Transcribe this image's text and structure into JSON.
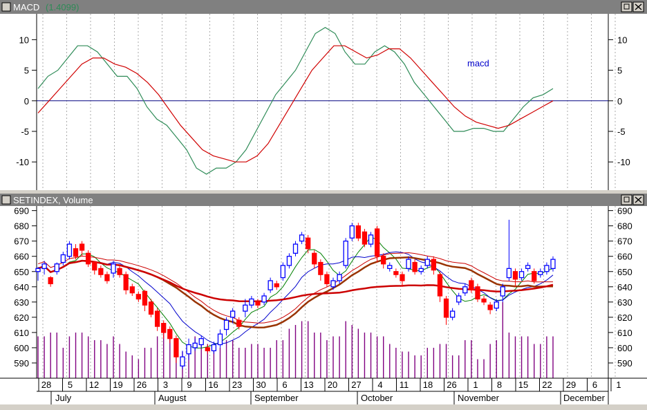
{
  "macd_pane": {
    "title": "MACD",
    "title_value": "(1.4099)",
    "annotation": "macd",
    "y_ticks": [
      10,
      5,
      0,
      -5,
      -10
    ],
    "ylim": [
      -14.5,
      14
    ]
  },
  "price_pane": {
    "title": "SETINDEX, Volume",
    "y_ticks": [
      690,
      680,
      670,
      660,
      650,
      640,
      630,
      620,
      610,
      600,
      590
    ],
    "ylim": [
      580,
      693
    ]
  },
  "x_axis": {
    "day_labels": [
      "28",
      "5",
      "12",
      "19",
      "26",
      "3",
      "9",
      "16",
      "23",
      "30",
      "6",
      "13",
      "20",
      "27",
      "4",
      "11",
      "18",
      "26",
      "1",
      "8",
      "15",
      "22",
      "29",
      "6",
      "1"
    ],
    "month_labels": [
      "July",
      "August",
      "September",
      "October",
      "November",
      "December"
    ]
  },
  "colors": {
    "background": "#ffffff",
    "chrome": "#d4d0c8",
    "title_bar": "#808080",
    "macd_line": "#2e8b57",
    "signal_line": "#d00000",
    "zero_line": "#000080",
    "up_candle": "#0000ff",
    "down_candle": "#ff0000",
    "volume": "#800080",
    "ma_short": "#008000",
    "ma_medium": "#0000cc",
    "ma_long": "#993300",
    "ma_longest": "#cc0000"
  },
  "chart_data": [
    {
      "type": "line",
      "title": "MACD",
      "series": [
        {
          "name": "macd",
          "values": [
            2,
            4,
            5,
            7,
            9,
            9,
            8,
            6,
            4,
            4,
            2,
            -1,
            -3,
            -4,
            -6,
            -8,
            -11,
            -12,
            -11,
            -11,
            -10,
            -8,
            -5,
            -2,
            1,
            3,
            5,
            8,
            11,
            12,
            11,
            8,
            6,
            6,
            8,
            9,
            8,
            6,
            3,
            1,
            -1,
            -3,
            -5,
            -5,
            -4.5,
            -4.5,
            -5,
            -5,
            -3,
            -1,
            0.5,
            1,
            2
          ]
        },
        {
          "values": [
            -2,
            0,
            2,
            4,
            6,
            7,
            7,
            6,
            5.5,
            4.5,
            3,
            1,
            -1.5,
            -4,
            -6,
            -8,
            -9,
            -9.5,
            -10,
            -10,
            -9,
            -7,
            -4,
            -1,
            2,
            5,
            7,
            9,
            9,
            8,
            7,
            7.5,
            8.5,
            8.5,
            7,
            5,
            3,
            1,
            -1,
            -2.5,
            -3.5,
            -4,
            -4.5,
            -4,
            -3,
            -2,
            -1,
            0
          ]
        }
      ],
      "ylim": [
        -14.5,
        14
      ]
    },
    {
      "type": "candlestick",
      "title": "SETINDEX, Volume",
      "series": [
        {
          "values": [
            [
              650,
              652,
              644,
              653
            ],
            [
              652,
              655,
              648,
              657
            ],
            [
              646,
              642,
              640,
              647
            ],
            [
              650,
              655,
              648,
              656
            ],
            [
              656,
              661,
              654,
              663
            ],
            [
              660,
              668,
              658,
              670
            ],
            [
              665,
              660,
              658,
              668
            ],
            [
              668,
              664,
              660,
              670
            ],
            [
              662,
              655,
              653,
              664
            ],
            [
              656,
              651,
              648,
              657
            ],
            [
              652,
              648,
              646,
              654
            ],
            [
              648,
              644,
              642,
              650
            ],
            [
              649,
              655,
              646,
              657
            ],
            [
              652,
              648,
              646,
              654
            ],
            [
              648,
              638,
              635,
              650
            ],
            [
              640,
              636,
              634,
              642
            ],
            [
              635,
              632,
              630,
              637
            ],
            [
              637,
              628,
              624,
              638
            ],
            [
              630,
              622,
              620,
              632
            ],
            [
              624,
              614,
              611,
              626
            ],
            [
              616,
              610,
              606,
              618
            ],
            [
              612,
              606,
              603,
              614
            ],
            [
              606,
              594,
              590,
              608
            ],
            [
              588,
              594,
              586,
              598
            ],
            [
              596,
              602,
              592,
              606
            ],
            [
              600,
              603,
              598,
              606
            ],
            [
              602,
              606,
              600,
              608
            ],
            [
              600,
              598,
              596,
              602
            ],
            [
              598,
              602,
              596,
              604
            ],
            [
              602,
              609,
              600,
              612
            ],
            [
              612,
              618,
              608,
              620
            ],
            [
              620,
              624,
              616,
              626
            ],
            [
              618,
              614,
              612,
              620
            ],
            [
              624,
              628,
              620,
              632
            ],
            [
              628,
              632,
              626,
              634
            ],
            [
              630,
              628,
              626,
              632
            ],
            [
              630,
              634,
              628,
              636
            ],
            [
              638,
              644,
              636,
              646
            ],
            [
              642,
              640,
              638,
              644
            ],
            [
              646,
              654,
              644,
              656
            ],
            [
              654,
              660,
              652,
              662
            ],
            [
              662,
              668,
              660,
              670
            ],
            [
              670,
              674,
              668,
              676
            ],
            [
              672,
              665,
              662,
              674
            ],
            [
              662,
              655,
              652,
              664
            ],
            [
              656,
              648,
              644,
              658
            ],
            [
              648,
              642,
              640,
              650
            ],
            [
              640,
              644,
              638,
              646
            ],
            [
              644,
              648,
              642,
              650
            ],
            [
              654,
              670,
              652,
              672
            ],
            [
              672,
              680,
              670,
              682
            ],
            [
              680,
              672,
              670,
              682
            ],
            [
              676,
              668,
              666,
              678
            ],
            [
              668,
              674,
              666,
              676
            ],
            [
              678,
              660,
              656,
              680
            ],
            [
              660,
              655,
              652,
              662
            ],
            [
              652,
              654,
              650,
              656
            ],
            [
              650,
              648,
              646,
              652
            ],
            [
              648,
              644,
              640,
              650
            ],
            [
              652,
              658,
              650,
              660
            ],
            [
              656,
              650,
              648,
              658
            ],
            [
              650,
              652,
              648,
              654
            ],
            [
              654,
              658,
              652,
              660
            ],
            [
              658,
              651,
              648,
              660
            ],
            [
              648,
              634,
              630,
              650
            ],
            [
              632,
              620,
              615,
              634
            ],
            [
              620,
              624,
              618,
              626
            ],
            [
              630,
              634,
              628,
              636
            ],
            [
              636,
              640,
              634,
              642
            ],
            [
              644,
              638,
              636,
              646
            ],
            [
              640,
              632,
              630,
              642
            ],
            [
              632,
              630,
              628,
              634
            ],
            [
              628,
              625,
              622,
              630
            ],
            [
              626,
              630,
              624,
              632
            ],
            [
              634,
              640,
              630,
              642
            ],
            [
              646,
              652,
              644,
              684
            ],
            [
              650,
              645,
              640,
              652
            ],
            [
              646,
              650,
              644,
              652
            ],
            [
              652,
              654,
              650,
              656
            ],
            [
              650,
              644,
              642,
              652
            ],
            [
              648,
              650,
              646,
              652
            ],
            [
              650,
              654,
              648,
              656
            ],
            [
              652,
              658,
              650,
              660
            ]
          ]
        },
        {
          "name": "Volume",
          "values": [
            110,
            110,
            120,
            120,
            80,
            110,
            120,
            120,
            110,
            100,
            100,
            90,
            110,
            90,
            70,
            60,
            50,
            80,
            80,
            110,
            120,
            120,
            80,
            70,
            70,
            110,
            100,
            90,
            80,
            80,
            100,
            100,
            80,
            80,
            90,
            90,
            80,
            80,
            100,
            100,
            130,
            140,
            150,
            150,
            120,
            120,
            100,
            110,
            110,
            150,
            140,
            130,
            120,
            120,
            110,
            110,
            90,
            80,
            70,
            70,
            60,
            60,
            80,
            80,
            90,
            90,
            60,
            60,
            100,
            100,
            50,
            50,
            90,
            100,
            200,
            120,
            110,
            110,
            110,
            90,
            90,
            110,
            110
          ]
        }
      ],
      "ylim": [
        580,
        693
      ]
    }
  ]
}
